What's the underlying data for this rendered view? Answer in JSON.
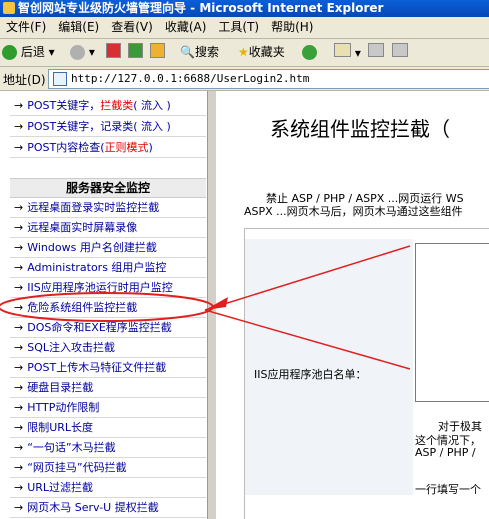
{
  "window": {
    "title": "智创网站专业级防火墙管理向导 - Microsoft Internet Explorer"
  },
  "menu": [
    "文件(F)",
    "编辑(E)",
    "查看(V)",
    "收藏(A)",
    "工具(T)",
    "帮助(H)"
  ],
  "toolbar": {
    "back": "后退",
    "search": "搜索",
    "favorites": "收藏夹"
  },
  "address": {
    "label": "地址(D)",
    "url": "http://127.0.0.1:6688/UserLogin2.htm"
  },
  "nav": {
    "top_items": [
      {
        "prefix": "POST关键字，",
        "highlight": "拦截类",
        "suffix": "( 流入 )"
      },
      {
        "prefix": "POST关键字，记录类( 流入 )",
        "highlight": "",
        "suffix": ""
      },
      {
        "prefix": "POST内容检查(",
        "highlight": "正则模式",
        "suffix": ")"
      }
    ],
    "section_title": "服务器安全监控",
    "items": [
      "远程桌面登录实时监控拦截",
      "远程桌面实时屏幕录像",
      "Windows 用户名创建拦截",
      "Administrators 组用户监控",
      "IIS应用程序池运行时用户监控",
      "危险系统组件监控拦截",
      "DOS命令和EXE程序监控拦截",
      "SQL注入攻击拦截",
      "POST上传木马特征文件拦截",
      "硬盘目录拦截",
      "HTTP动作限制",
      "限制URL长度",
      "“一句话”木马拦截",
      "“网页挂马”代码拦截",
      "URL过滤拦截",
      "网页木马 Serv-U 提权拦截"
    ]
  },
  "main": {
    "title": "系统组件监控拦截（",
    "desc_line1": "禁止 ASP / PHP / ASPX ...网页运行 WS",
    "desc_line2": "ASPX ...网页木马后，网页木马通过这些组件",
    "whitelist_label": "IIS应用程序池白名单：",
    "side_line1": "对于极其",
    "side_line2": "这个情况下，",
    "side_line3": "ASP / PHP /",
    "side_line4": "一行填写一个"
  },
  "colors": {
    "arrow": "#e02020",
    "title_bar": "#0a5fd8",
    "link": "#0000a0",
    "highlight": "#e00000"
  }
}
